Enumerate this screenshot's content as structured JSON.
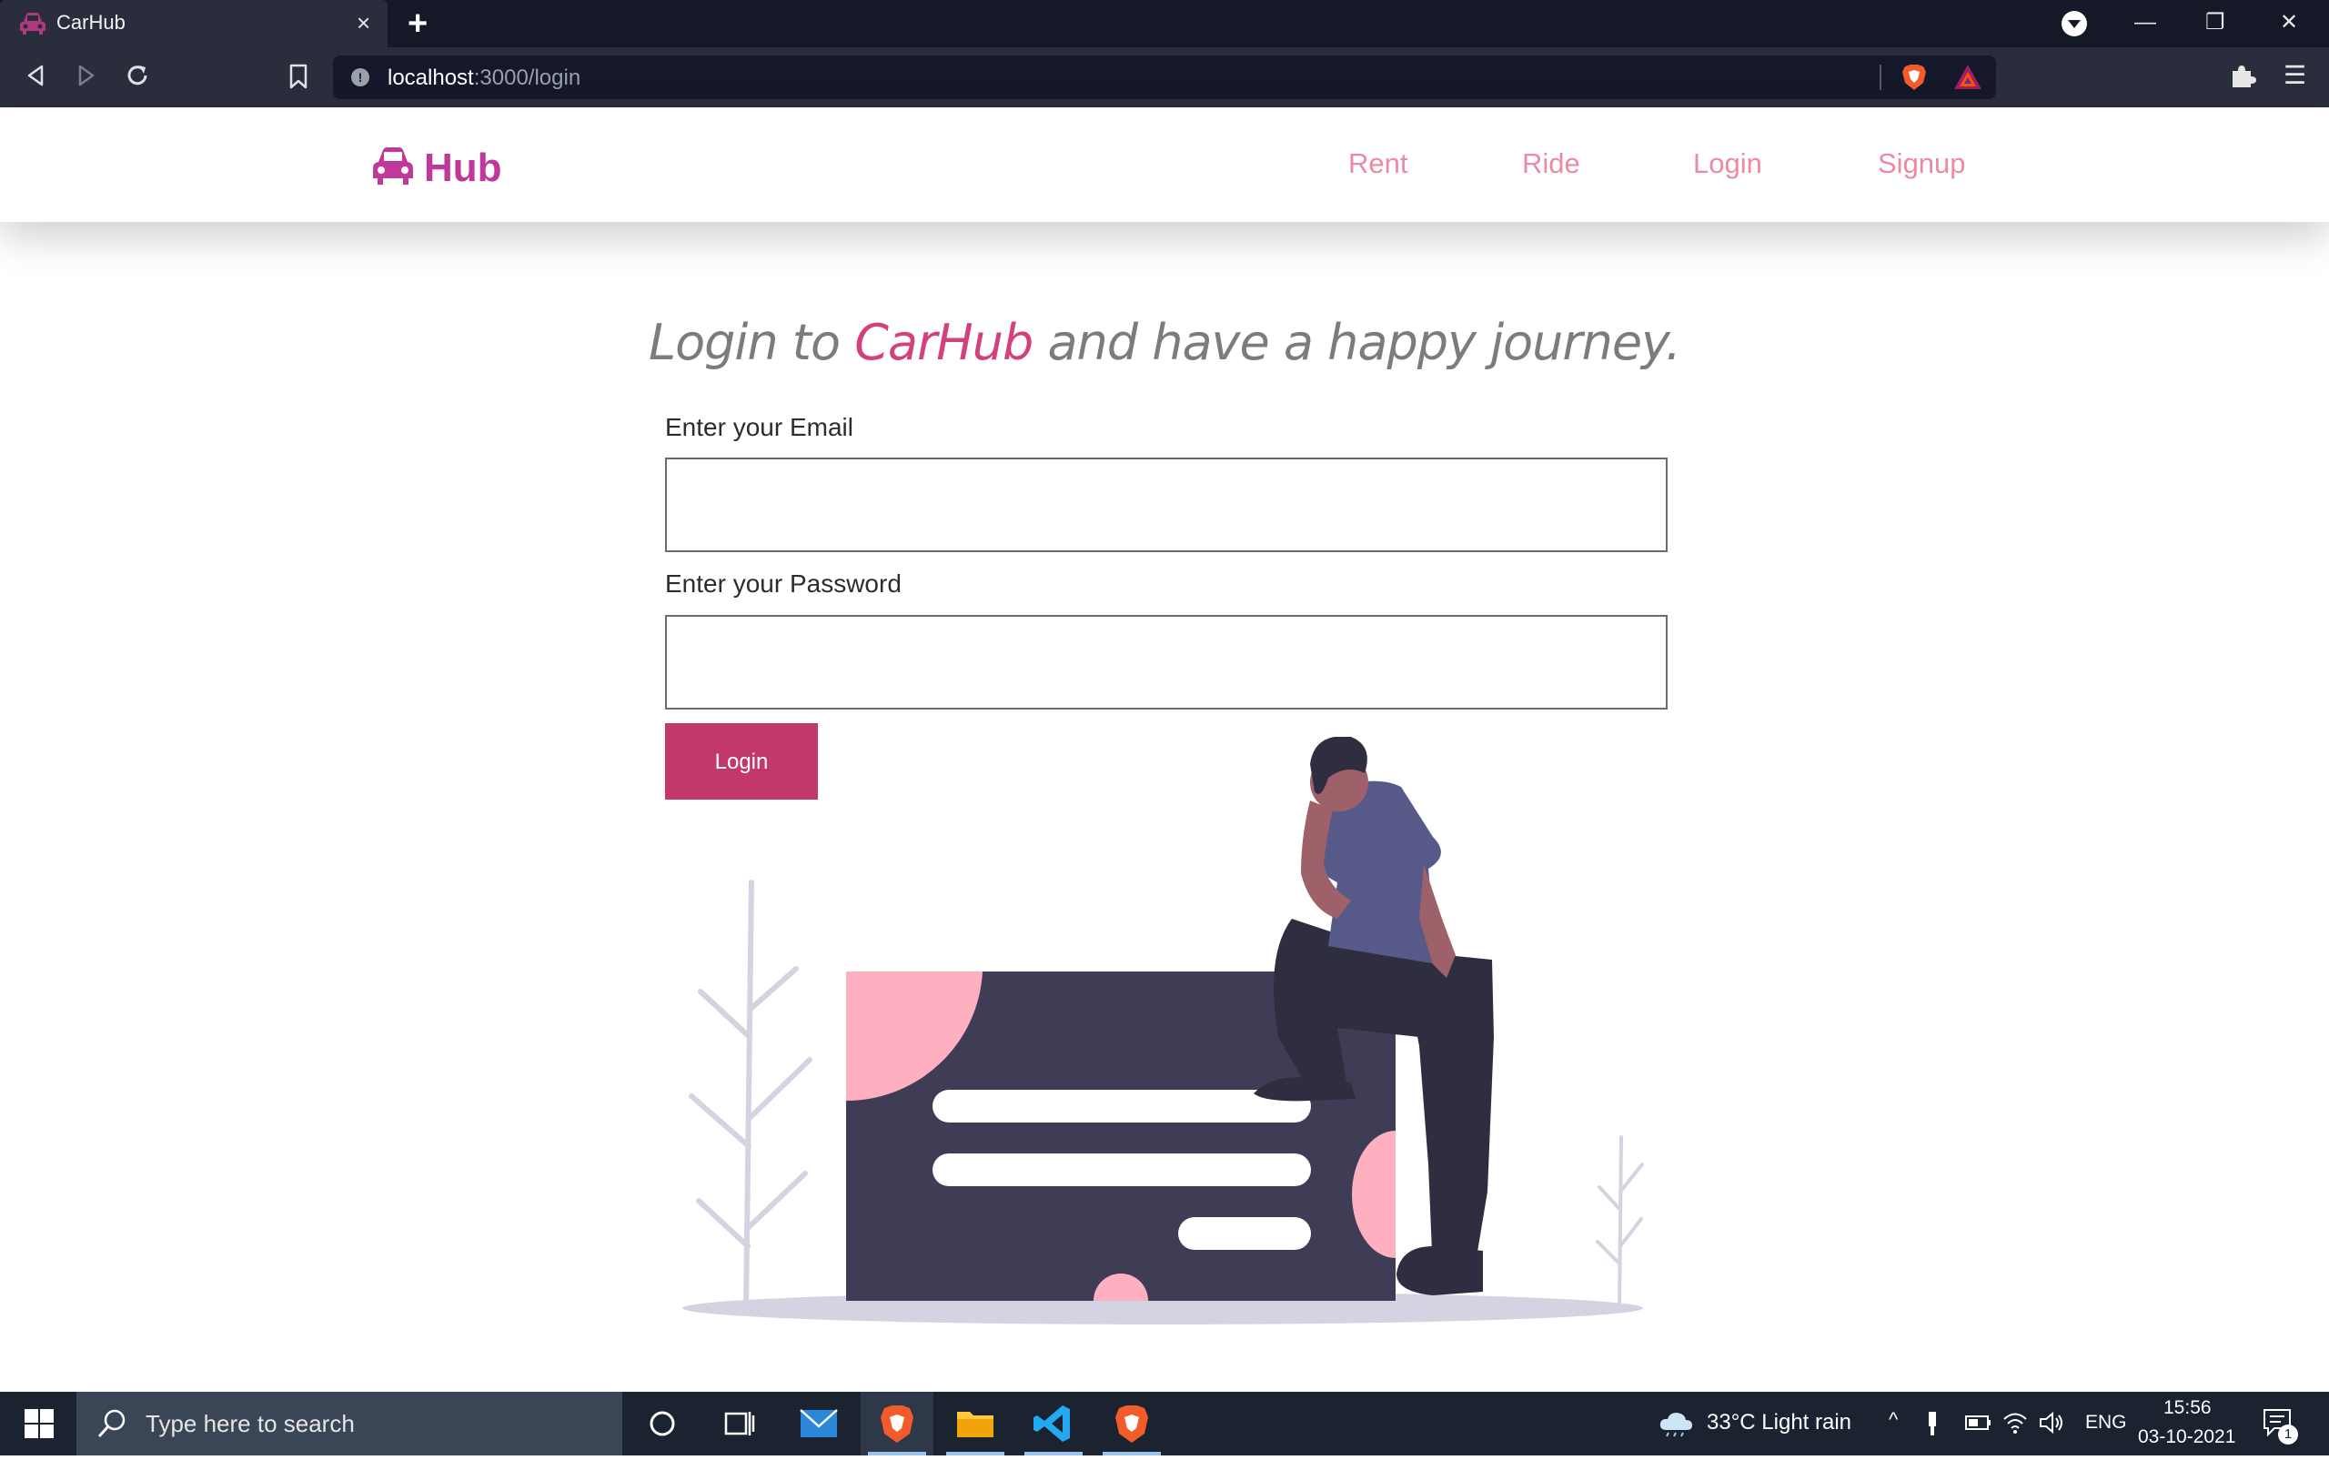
{
  "browser": {
    "tab_title": "CarHub",
    "tab_close": "×",
    "new_tab": "+",
    "url_host": "localhost",
    "url_path": ":3000/login",
    "info": "!"
  },
  "site": {
    "logo_text": "Hub",
    "nav": [
      "Rent",
      "Ride",
      "Login",
      "Signup"
    ]
  },
  "page": {
    "headline_pre": "Login to ",
    "headline_brand": "CarHub",
    "headline_post": " and have a happy journey.",
    "email_label": "Enter your Email",
    "password_label": "Enter your Password",
    "email_value": "",
    "password_value": "",
    "login_button": "Login"
  },
  "taskbar": {
    "search_placeholder": "Type here to search",
    "weather": "33°C  Light rain",
    "language": "ENG",
    "time": "15:56",
    "date": "03-10-2021",
    "notification_count": "1"
  },
  "colors": {
    "brand_pink": "#d43f7e",
    "button": "#c2386a",
    "nav_link": "#ec8aa4",
    "logo": "#c0399a"
  }
}
